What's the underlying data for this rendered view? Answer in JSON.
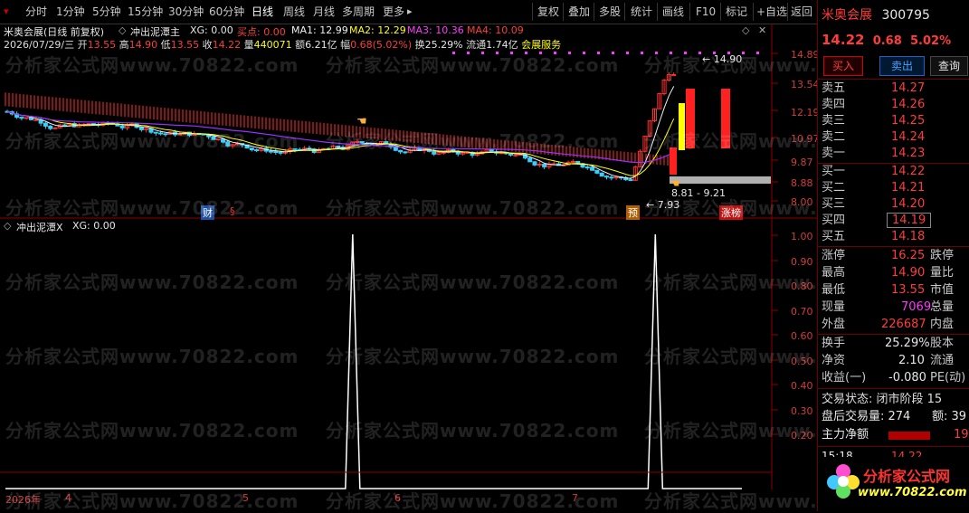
{
  "toolbar": {
    "periods": [
      "分时",
      "1分钟",
      "5分钟",
      "15分钟",
      "30分钟",
      "60分钟",
      "日线",
      "周线",
      "月线",
      "多周期",
      "更多"
    ],
    "active": "日线",
    "actions": [
      "复权",
      "叠加",
      "多股",
      "统计",
      "画线",
      "F10",
      "标记",
      "+自选",
      "返回"
    ]
  },
  "kline": {
    "header_name": "米奥会展(日线 前复权)",
    "formula": "冲出泥潭主",
    "xg": "XG: 0.00",
    "buy_point": "买点: 0.00",
    "ma1": "MA1: 12.99",
    "ma2": "MA2: 12.29",
    "ma3": "MA3: 10.36",
    "ma4": "MA4: 10.09",
    "date": "2026/07/29/三",
    "open_l": "开",
    "open": "13.55",
    "high_l": "高",
    "high": "14.90",
    "low_l": "低",
    "low": "13.55",
    "close_l": "收",
    "close": "14.22",
    "vol_l": "量",
    "vol": "440071",
    "amt_l": "额",
    "amt": "6.21亿",
    "amp_l": "幅",
    "amp": "0.68(5.02%)",
    "turn_l": "换",
    "turn": "25.29%",
    "float_l": "流通",
    "float": "1.74亿",
    "service": "会展服务",
    "y_ticks": [
      "14.89",
      "13.54",
      "12.19",
      "10.97",
      "9.87",
      "8.88",
      "8.00"
    ],
    "annot_high": "14.90",
    "annot_low": "7.93",
    "annot_range": "8.81 - 9.21",
    "tags": [
      "财",
      "§",
      "预",
      "涨榜"
    ]
  },
  "indicator": {
    "title": "冲出泥潭X",
    "xg": "XG: 0.00",
    "y_ticks": [
      "1.00",
      "0.90",
      "0.80",
      "0.70",
      "0.60",
      "0.50",
      "0.40",
      "0.30",
      "0.20"
    ],
    "x_labels": [
      "2026年",
      "4",
      "5",
      "6",
      "7"
    ]
  },
  "chart_data": {
    "type": "line",
    "title": "冲出泥潭X",
    "series": [
      {
        "name": "XG",
        "spikes_at_fraction": [
          0.468,
          0.876
        ],
        "values_at_spikes": [
          1.0,
          1.0
        ],
        "baseline": 0.0
      }
    ],
    "ylim": [
      0,
      1.0
    ]
  },
  "quote": {
    "name": "米奥会展",
    "code": "300795",
    "price": "14.22",
    "change": "0.68",
    "pct": "5.02%",
    "buy_btn": "买入",
    "sell_btn": "卖出",
    "query_btn": "查询",
    "asks": [
      {
        "l": "卖五",
        "p": "14.27"
      },
      {
        "l": "卖四",
        "p": "14.26"
      },
      {
        "l": "卖三",
        "p": "14.25"
      },
      {
        "l": "卖二",
        "p": "14.24"
      },
      {
        "l": "卖一",
        "p": "14.23"
      }
    ],
    "bids": [
      {
        "l": "买一",
        "p": "14.22"
      },
      {
        "l": "买二",
        "p": "14.21"
      },
      {
        "l": "买三",
        "p": "14.20"
      },
      {
        "l": "买四",
        "p": "14.19"
      },
      {
        "l": "买五",
        "p": "14.18"
      }
    ],
    "stats": [
      {
        "l": "涨停",
        "v": "16.25",
        "r": "跌停"
      },
      {
        "l": "最高",
        "v": "14.90",
        "r": "量比"
      },
      {
        "l": "最低",
        "v": "13.55",
        "r": "市值"
      },
      {
        "l": "现量",
        "v": "7069",
        "r": "总量"
      },
      {
        "l": "外盘",
        "v": "226687",
        "r": "内盘"
      }
    ],
    "stats2": [
      {
        "l": "换手",
        "v": "25.29%",
        "r": "股本"
      },
      {
        "l": "净资",
        "v": "2.10",
        "r": "流通"
      },
      {
        "l": "收益(一)",
        "v": "-0.080",
        "r": "PE(动)"
      }
    ],
    "trade_state": "交易状态: 闭市阶段 15",
    "after_vol": "盘后交易量: 274",
    "after_amt": "额: 39",
    "main_label": "主力净额",
    "main_val": "19",
    "tick_time": "15:18",
    "tick_price": "14.22"
  },
  "brand": {
    "logo": "分析家公式网",
    "url": "www.70822.com",
    "watermark": "分析家公式网www.70822.com"
  }
}
